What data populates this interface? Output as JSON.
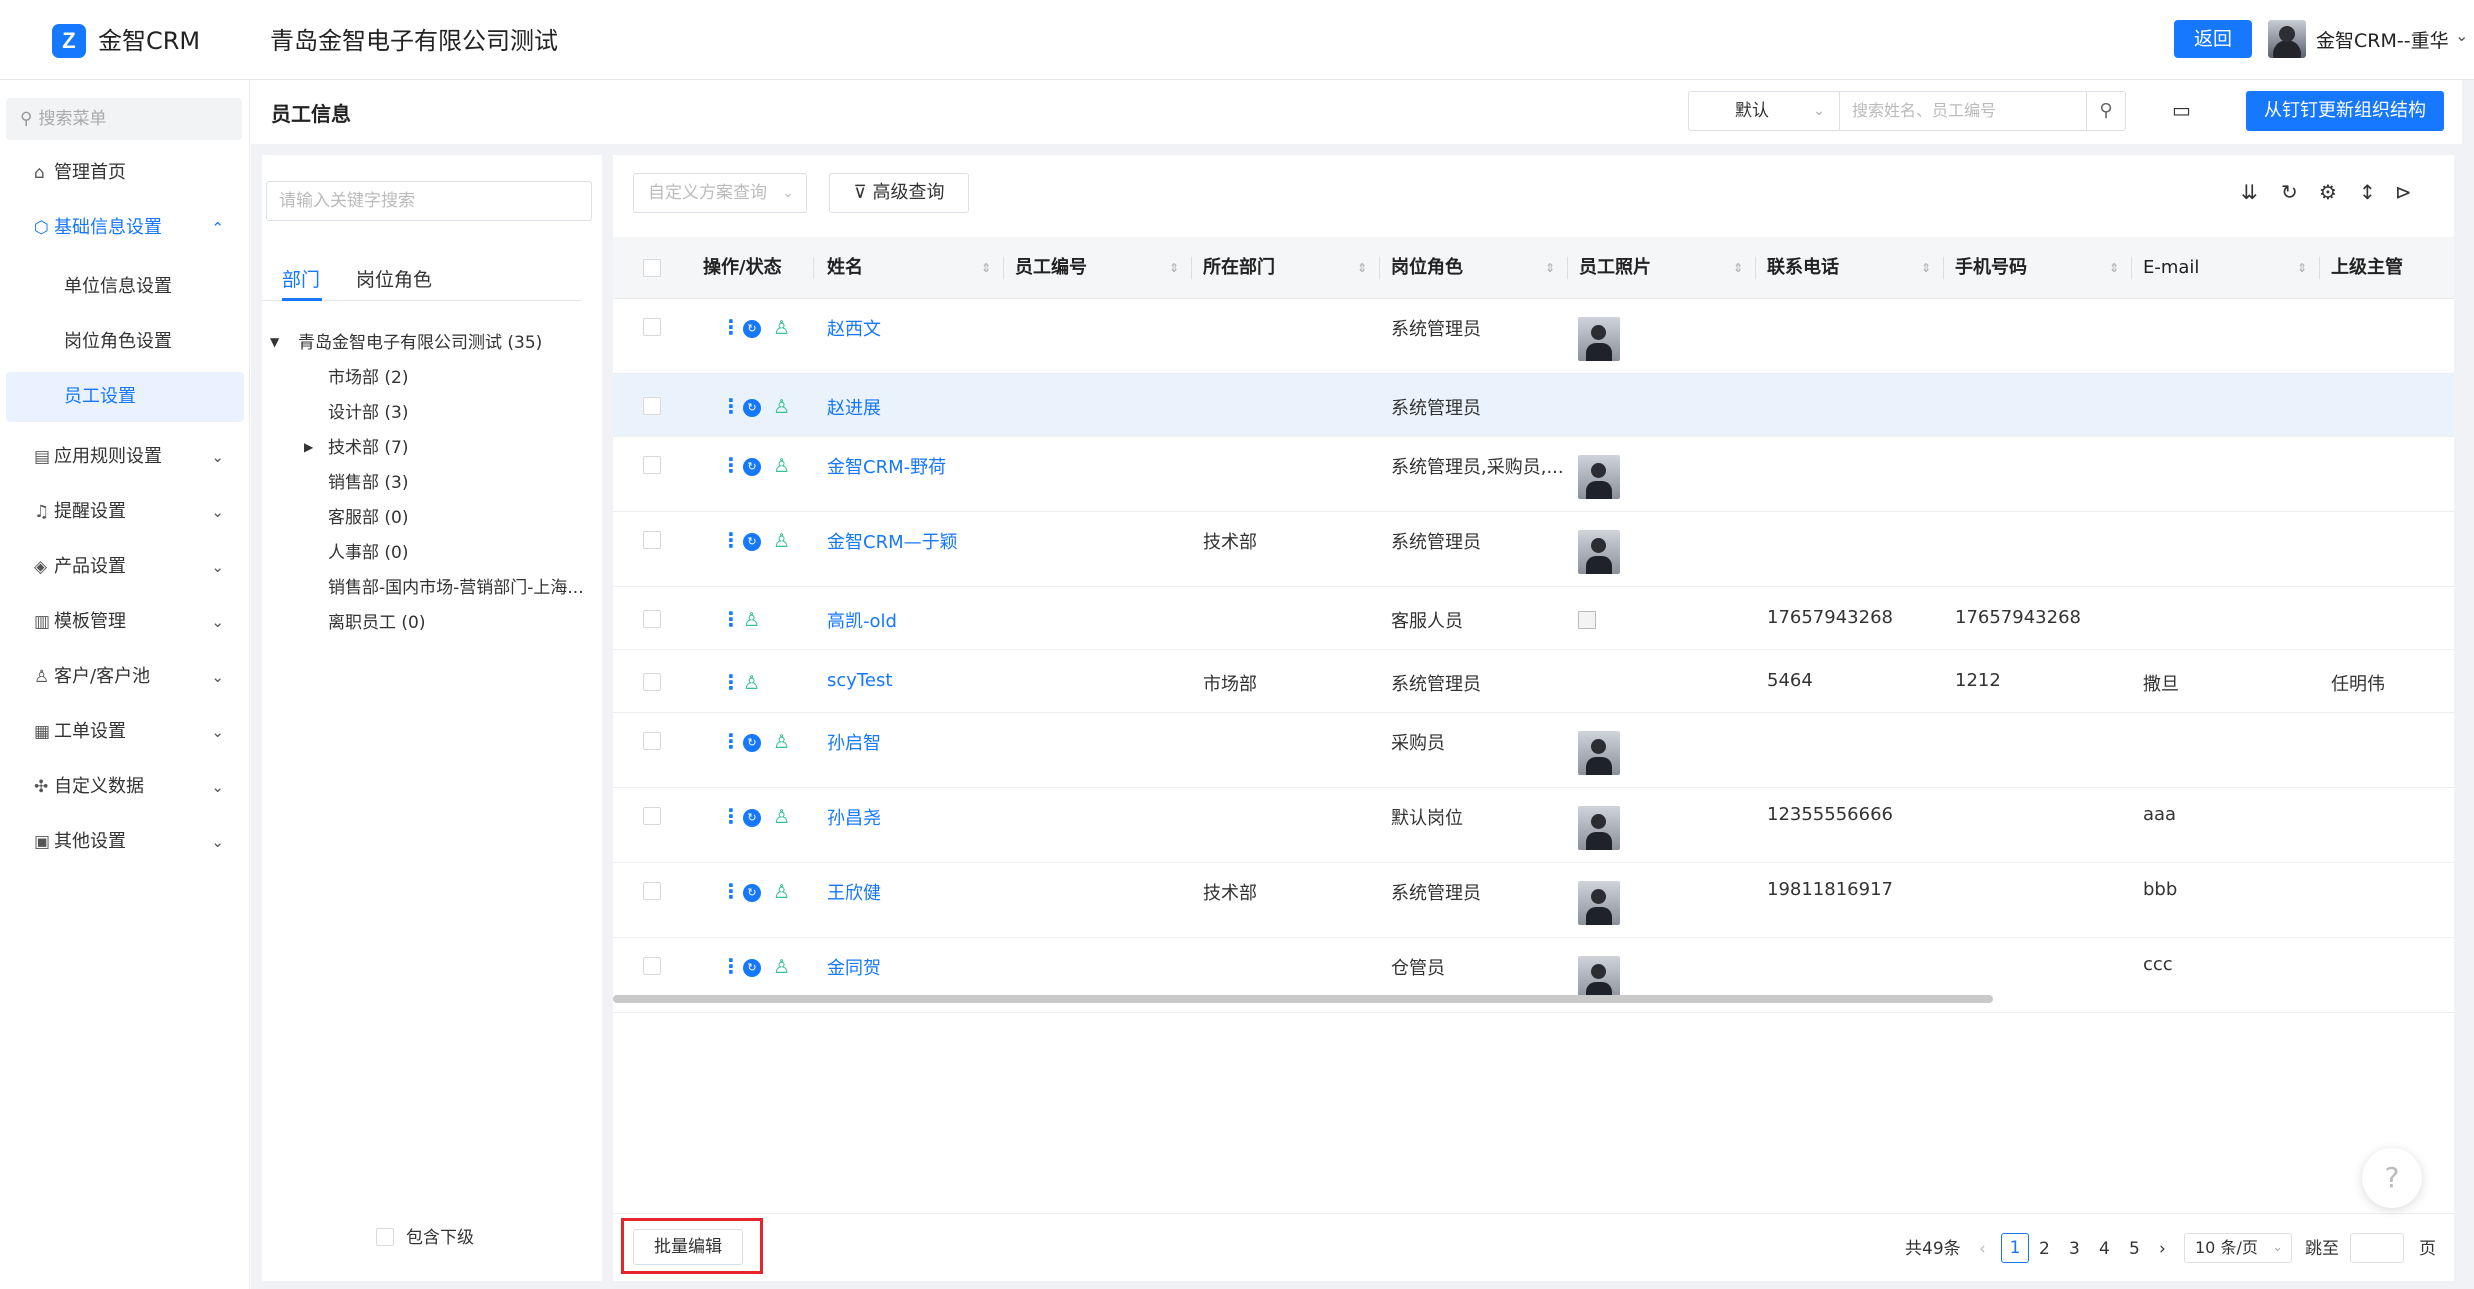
{
  "header": {
    "logo_text": "金智CRM",
    "company": "青岛金智电子有限公司测试",
    "back_label": "返回",
    "user_name": "金智CRM--重华"
  },
  "sidebar": {
    "search_placeholder": "搜索菜单",
    "items": [
      {
        "label": "管理首页",
        "icon": "home-icon"
      },
      {
        "label": "基础信息设置",
        "icon": "cube-icon",
        "expanded": true
      },
      {
        "label": "应用规则设置",
        "icon": "doc-icon"
      },
      {
        "label": "提醒设置",
        "icon": "bell-icon"
      },
      {
        "label": "产品设置",
        "icon": "box-icon"
      },
      {
        "label": "模板管理",
        "icon": "template-icon"
      },
      {
        "label": "客户/客户池",
        "icon": "customer-icon"
      },
      {
        "label": "工单设置",
        "icon": "ticket-icon"
      },
      {
        "label": "自定义数据",
        "icon": "custom-data-icon"
      },
      {
        "label": "其他设置",
        "icon": "grid-icon"
      }
    ],
    "sub_items": [
      "单位信息设置",
      "岗位角色设置",
      "员工设置"
    ]
  },
  "page": {
    "title": "员工信息",
    "scheme": "默认",
    "search_placeholder": "搜索姓名、员工编号",
    "sync_label": "从钉钉更新组织结构"
  },
  "dept": {
    "search_placeholder": "请输入关键字搜索",
    "tabs": [
      "部门",
      "岗位角色"
    ],
    "root": "青岛金智电子有限公司测试 (35)",
    "children": [
      "市场部 (2)",
      "设计部 (3)",
      "技术部 (7)",
      "销售部 (3)",
      "客服部 (0)",
      "人事部 (0)",
      "销售部-国内市场-营销部门-上海...",
      "离职员工 (0)"
    ],
    "include_sub": "包含下级"
  },
  "grid": {
    "custom_query_placeholder": "自定义方案查询",
    "advanced_query": "高级查询",
    "columns": [
      "操作/状态",
      "姓名",
      "员工编号",
      "所在部门",
      "岗位角色",
      "员工照片",
      "联系电话",
      "手机号码",
      "E-mail",
      "上级主管"
    ],
    "rows": [
      {
        "name": "赵西文",
        "code": "",
        "dept": "",
        "role": "系统管理员",
        "photo": "photo",
        "tel": "",
        "mobile": "",
        "email": "",
        "manager": ""
      },
      {
        "name": "赵进展",
        "code": "",
        "dept": "",
        "role": "系统管理员",
        "photo": "",
        "tel": "",
        "mobile": "",
        "email": "",
        "manager": ""
      },
      {
        "name": "金智CRM-野荷",
        "code": "",
        "dept": "",
        "role": "系统管理员,采购员,...",
        "photo": "photo",
        "tel": "",
        "mobile": "",
        "email": "",
        "manager": ""
      },
      {
        "name": "金智CRM—于颖",
        "code": "",
        "dept": "技术部",
        "role": "系统管理员",
        "photo": "photo",
        "tel": "",
        "mobile": "",
        "email": "",
        "manager": ""
      },
      {
        "name": "高凯-old",
        "code": "",
        "dept": "",
        "role": "客服人员",
        "photo": "broken",
        "tel": "17657943268",
        "mobile": "17657943268",
        "email": "",
        "manager": ""
      },
      {
        "name": "scyTest",
        "code": "",
        "dept": "市场部",
        "role": "系统管理员",
        "photo": "",
        "tel": "5464",
        "mobile": "1212",
        "email": "撒旦",
        "manager": "任明伟"
      },
      {
        "name": "孙启智",
        "code": "",
        "dept": "",
        "role": "采购员",
        "photo": "photo",
        "tel": "",
        "mobile": "",
        "email": "",
        "manager": ""
      },
      {
        "name": "孙昌尧",
        "code": "",
        "dept": "",
        "role": "默认岗位",
        "photo": "photo",
        "tel": "12355556666",
        "mobile": "",
        "email": "aaa",
        "manager": ""
      },
      {
        "name": "王欣健",
        "code": "",
        "dept": "技术部",
        "role": "系统管理员",
        "photo": "photo",
        "tel": "19811816917",
        "mobile": "",
        "email": "bbb",
        "manager": ""
      },
      {
        "name": "金同贺",
        "code": "",
        "dept": "",
        "role": "仓管员",
        "photo": "photo",
        "tel": "",
        "mobile": "",
        "email": "ccc",
        "manager": ""
      }
    ]
  },
  "footer": {
    "batch_edit": "批量编辑",
    "total": "共49条",
    "pages": [
      "1",
      "2",
      "3",
      "4",
      "5"
    ],
    "page_size": "10 条/页",
    "jump_label": "跳至",
    "page_unit": "页"
  }
}
